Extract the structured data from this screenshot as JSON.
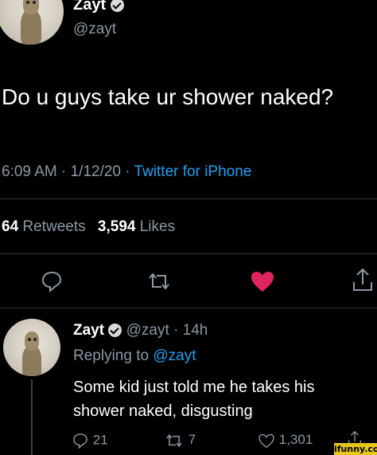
{
  "tweet": {
    "author_name": "Zayt",
    "author_handle": "@zayt",
    "text": "Do u guys take ur shower naked?",
    "time": "6:09 AM · 1/12/20 · ",
    "source": "Twitter for iPhone",
    "retweets_count": "64",
    "retweets_label": "Retweets",
    "likes_count": "3,594",
    "likes_label": "Likes",
    "icons": [
      "reply-icon",
      "retweet-icon",
      "heart-icon",
      "share-icon"
    ],
    "like_color": "#e0245e"
  },
  "reply": {
    "author_name": "Zayt",
    "author_handle": "@zayt",
    "time_ago": "· 14h",
    "replying_to_label": "Replying to",
    "replying_to_handle": "@zayt",
    "text_line1": "Some kid just told me he takes his",
    "text_line2": "shower naked, disgusting",
    "reply_count": "21",
    "retweet_count": "7",
    "like_count": "1,301"
  },
  "accent_color": "#1da1f2",
  "watermark": "ifunny.co"
}
